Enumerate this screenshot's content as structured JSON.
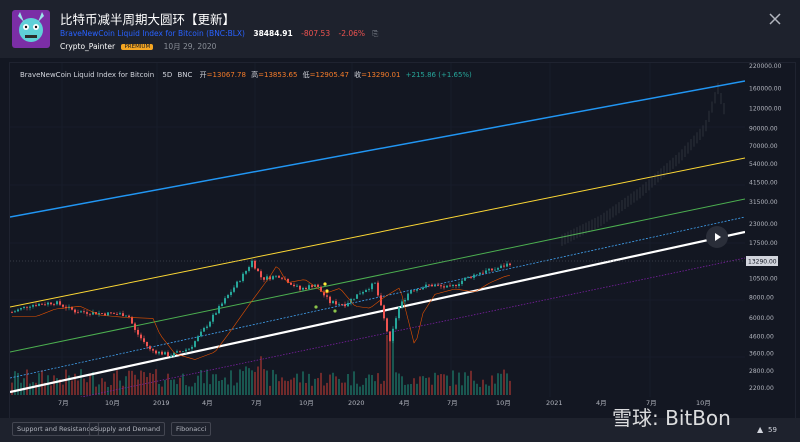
{
  "header": {
    "title": "比特币减半周期大圆环【更新】",
    "symbol_name": "BraveNewCoin Liquid Index for Bitcoin",
    "symbol_code": "(BNC:BLX)",
    "price": "38484.91",
    "change": "-807.53",
    "change_pct": "-2.06%",
    "author": "Crypto_Painter",
    "badge": "PREMIUM",
    "date": "10月 29, 2020"
  },
  "legend": {
    "name": "BraveNewCoin Liquid Index for Bitcoin",
    "interval": "5D",
    "exchange": "BNC",
    "open_label": "开",
    "open": "=13067.78",
    "high_label": "高",
    "high": "=13853.65",
    "low_label": "低",
    "low": "=12905.47",
    "close_label": "收",
    "close": "=13290.01",
    "change": "+215.86 (+1.65%)"
  },
  "chart_data": {
    "type": "line",
    "title": "BraveNewCoin Liquid Index for Bitcoin 5D BNC",
    "scale": "log",
    "y_ticks": [
      "220000.00",
      "160000.00",
      "120000.00",
      "90000.00",
      "70000.00",
      "54000.00",
      "41500.00",
      "31500.00",
      "23000.00",
      "17500.00",
      "13290.00",
      "10500.00",
      "8000.00",
      "6000.00",
      "4600.00",
      "3600.00",
      "2800.00",
      "2200.00"
    ],
    "current_price_label": "13290.00",
    "x_ticks": [
      "7月",
      "10月",
      "2019",
      "4月",
      "7月",
      "10月",
      "2020",
      "4月",
      "7月",
      "10月",
      "2021",
      "4月",
      "7月",
      "10月"
    ],
    "colors": {
      "band_blue": "#2196f3",
      "band_yellow": "#ffeb3b",
      "band_green": "#4caf50",
      "band_lightblue": "#42a5f5",
      "band_white": "#ffffff",
      "band_purple": "#7b1fa2",
      "up": "#26a69a",
      "down": "#ef5350"
    }
  },
  "footer": {
    "tabs": [
      "Support and Resistance",
      "Supply and Demand",
      "Fibonacci"
    ],
    "watermark": "雪球: BitBon",
    "count": "59"
  }
}
